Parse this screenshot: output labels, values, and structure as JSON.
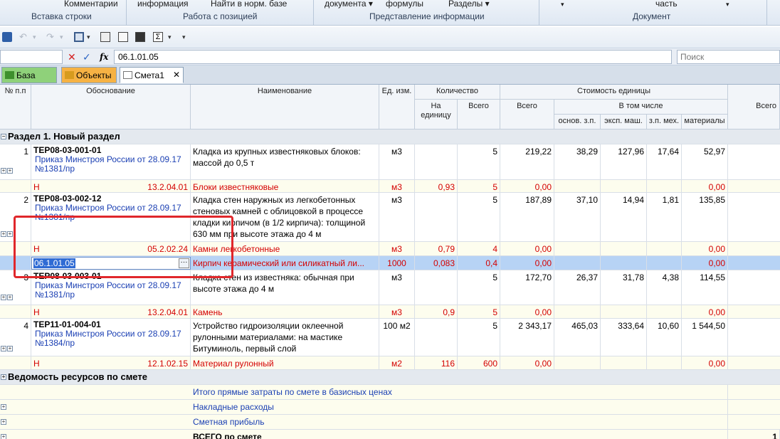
{
  "ribbon": {
    "top_labels": [
      "Комментарии",
      "информация",
      "Найти в норм. базе",
      "документа",
      "формулы",
      "Разделы",
      "часть"
    ],
    "groups": [
      "Вставка строки",
      "Работа с позицией",
      "Представление информации",
      "Документ"
    ]
  },
  "formula_bar": {
    "value": "06.1.01.05",
    "search_placeholder": "Поиск"
  },
  "tabs": [
    {
      "label": "База"
    },
    {
      "label": "Объекты"
    },
    {
      "label": "Смета1"
    }
  ],
  "headers": {
    "num": "№ п.п",
    "basis": "Обоснование",
    "name": "Наименование",
    "unit": "Ед. изм.",
    "qty": "Количество",
    "qty_per": "На единицу",
    "qty_total": "Всего",
    "cost": "Стоимость единицы",
    "cost_total": "Всего",
    "incl": "В том числе",
    "wage": "основ. з.п.",
    "mach": "эксп. маш.",
    "mech": "з.п. мех.",
    "mat": "материалы",
    "grand": "Всего"
  },
  "section1": "Раздел 1. Новый раздел",
  "rows": [
    {
      "num": "1",
      "code": "ТЕР08-03-001-01",
      "doc": "Приказ Минстроя России от 28.09.17 №1381/пр",
      "name": "Кладка из крупных известняковых блоков: массой до 0,5 т",
      "unit": "м3",
      "qty": "5",
      "total": "219,22",
      "wage": "38,29",
      "mach": "127,96",
      "mech": "17,64",
      "mat": "52,97",
      "res": [
        {
          "h": "Н",
          "code": "13.2.04.01",
          "name": "Блоки известняковые",
          "unit": "м3",
          "per": "0,93",
          "qty": "5",
          "total": "0,00",
          "mat": "0,00"
        }
      ]
    },
    {
      "num": "2",
      "code": "ТЕР08-03-002-12",
      "doc": "Приказ Минстроя России от 28.09.17 №1381/пр",
      "name": "Кладка стен наружных из легкобетонных стеновых камней с облицовкой в процессе кладки кирпичом (в 1/2 кирпича): толщиной 630 мм при высоте этажа до 4 м",
      "unit": "м3",
      "qty": "5",
      "total": "187,89",
      "wage": "37,10",
      "mach": "14,94",
      "mech": "1,81",
      "mat": "135,85",
      "res": [
        {
          "h": "Н",
          "code": "05.2.02.24",
          "name": "Камни легкобетонные",
          "unit": "м3",
          "per": "0,79",
          "qty": "4",
          "total": "0,00",
          "mat": "0,00"
        },
        {
          "h": "",
          "code": "06.1.01.05",
          "name": "Кирпич керамический или силикатный ли...",
          "unit": "1000",
          "per": "0,083",
          "qty": "0,4",
          "total": "0,00",
          "mat": "0,00"
        }
      ]
    },
    {
      "num": "3",
      "code": "ТЕР08-03-003-01",
      "doc": "Приказ Минстроя России от 28.09.17 №1381/пр",
      "name": "Кладка стен из известняка: обычная при высоте этажа до 4 м",
      "unit": "м3",
      "qty": "5",
      "total": "172,70",
      "wage": "26,37",
      "mach": "31,78",
      "mech": "4,38",
      "mat": "114,55",
      "res": [
        {
          "h": "Н",
          "code": "13.2.04.01",
          "name": "Камень",
          "unit": "м3",
          "per": "0,9",
          "qty": "5",
          "total": "0,00",
          "mat": "0,00"
        }
      ]
    },
    {
      "num": "4",
      "code": "ТЕР11-01-004-01",
      "doc": "Приказ Минстроя России от 28.09.17 №1384/пр",
      "name": "Устройство гидроизоляции оклеечной рулонными материалами: на мастике Битуминоль, первый слой",
      "unit": "100 м2",
      "qty": "5",
      "total": "2 343,17",
      "wage": "465,03",
      "mach": "333,64",
      "mech": "10,60",
      "mat": "1 544,50",
      "res": [
        {
          "h": "Н",
          "code": "12.1.02.15",
          "name": "Материал рулонный",
          "unit": "м2",
          "per": "116",
          "qty": "600",
          "total": "0,00",
          "mat": "0,00"
        }
      ]
    }
  ],
  "section2": "Ведомость ресурсов по смете",
  "summary": [
    "Итого прямые затраты по смете в базисных ценах",
    "Накладные расходы",
    "Сметная прибыль",
    "ВСЕГО по смете"
  ],
  "grand_total_fragment": "1"
}
